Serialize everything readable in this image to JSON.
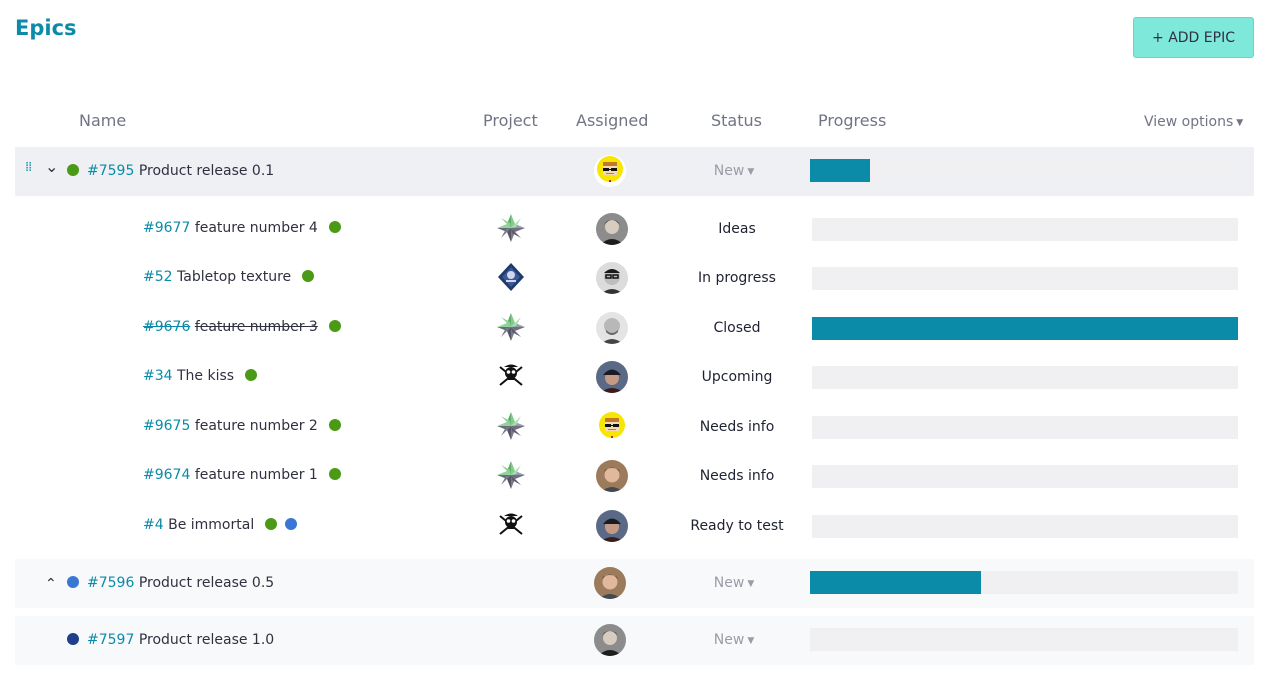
{
  "page": {
    "title": "Epics"
  },
  "actions": {
    "add_epic": "+ ADD EPIC",
    "view_options": "View options"
  },
  "columns": {
    "name": "Name",
    "project": "Project",
    "assigned": "Assigned",
    "status": "Status",
    "progress": "Progress"
  },
  "colors": {
    "accent": "#0b8ba7",
    "button": "#7ee8db",
    "bar_bg": "#f0f0f2",
    "green": "#4a9a16",
    "blue": "#3a77d4",
    "navy": "#1e3f8a"
  },
  "epics": [
    {
      "ref": "#7595",
      "subject": "Product release 0.1",
      "color": "#4a9a16",
      "assigned": "pixel-avatar-glasses",
      "status": "New",
      "progress": 0.14,
      "expanded": true,
      "stories": [
        {
          "ref": "#9677",
          "subject": "feature number 4",
          "dots": [
            "#4a9a16"
          ],
          "project": "star-logo",
          "assigned": "dark-hair-man",
          "status": "Ideas",
          "progress": 0,
          "closed": false
        },
        {
          "ref": "#52",
          "subject": "Tabletop texture",
          "dots": [
            "#4a9a16"
          ],
          "project": "hex-badge-logo",
          "assigned": "man-with-glasses",
          "status": "In progress",
          "progress": 0,
          "closed": false
        },
        {
          "ref": "#9676",
          "subject": "feature number 3",
          "dots": [
            "#4a9a16"
          ],
          "project": "star-logo",
          "assigned": "bald-man",
          "status": "Closed",
          "progress": 1,
          "closed": true
        },
        {
          "ref": "#34",
          "subject": "The kiss",
          "dots": [
            "#4a9a16"
          ],
          "project": "pirate-logo",
          "assigned": "man-in-cap",
          "status": "Upcoming",
          "progress": 0,
          "closed": false
        },
        {
          "ref": "#9675",
          "subject": "feature number 2",
          "dots": [
            "#4a9a16"
          ],
          "project": "star-logo",
          "assigned": "pixel-avatar-glasses",
          "status": "Needs info",
          "progress": 0,
          "closed": false
        },
        {
          "ref": "#9674",
          "subject": "feature number 1",
          "dots": [
            "#4a9a16"
          ],
          "project": "star-logo",
          "assigned": "young-man",
          "status": "Needs info",
          "progress": 0,
          "closed": false
        },
        {
          "ref": "#4",
          "subject": "Be immortal",
          "dots": [
            "#4a9a16",
            "#3a77d4"
          ],
          "project": "pirate-logo",
          "assigned": "man-in-cap",
          "status": "Ready to test",
          "progress": 0,
          "closed": false
        }
      ]
    },
    {
      "ref": "#7596",
      "subject": "Product release 0.5",
      "color": "#3a77d4",
      "assigned": "young-man",
      "status": "New",
      "progress": 0.4,
      "expanded": false,
      "stories": []
    },
    {
      "ref": "#7597",
      "subject": "Product release 1.0",
      "color": "#1e3f8a",
      "assigned": "dark-hair-man",
      "status": "New",
      "progress": 0,
      "expanded": null,
      "stories": []
    }
  ]
}
